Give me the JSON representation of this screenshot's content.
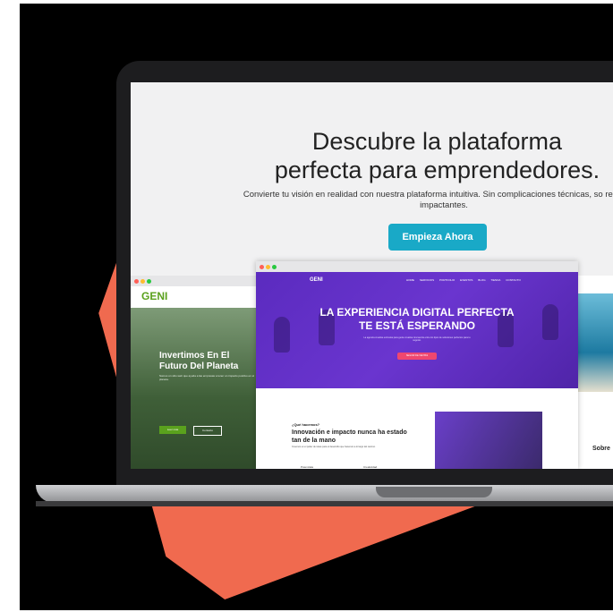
{
  "hero": {
    "title_line1": "Descubre la plataforma",
    "title_line2": "perfecta para emprendedores.",
    "subtitle": "Convierte tu visión en realidad con nuestra plataforma intuitiva. Sin complicaciones técnicas, so resultados impactantes.",
    "cta_label": "Empieza Ahora"
  },
  "left_site": {
    "logo": "GENI",
    "headline": "Invertimos En El Futuro Del Planeta",
    "body": "Somos un sitio web que ayuda a las empresas a tener un impacto positivo en el planeta.",
    "button1": "Leer más",
    "button2": "Contacto"
  },
  "center_site": {
    "logo": "GENI",
    "nav": [
      "HOME",
      "SERVICIOS",
      "PORTFOLIO",
      "EVENTOS",
      "BLOG",
      "TIENDA",
      "CONTACTO"
    ],
    "headline_line1": "LA EXPERIENCIA DIGITAL PERFECTA",
    "headline_line2": "TE ESTÁ ESPERANDO",
    "subtext": "La agencia creativa exclusiva para gente creativa. Encuentra entre los tipos de soluciones perfectos para tu negocio.",
    "hero_button": "SEGUIR DE VENTAS",
    "section_kicker": "¿Qué hacemos?",
    "section_title": "Innovación e impacto nunca ha estado tan de la mano",
    "section_body": "Creemos en el poder de ideas para el desarrollo que hacemos a lo largo del camino.",
    "feature1": "Potenciala",
    "feature2": "Creatividad"
  },
  "right_site": {
    "section_title": "Sobre"
  },
  "colors": {
    "accent_cta": "#19a9c7",
    "coral": "#f06a4f",
    "purple": "#5b2bbf",
    "green": "#5aa11d"
  }
}
